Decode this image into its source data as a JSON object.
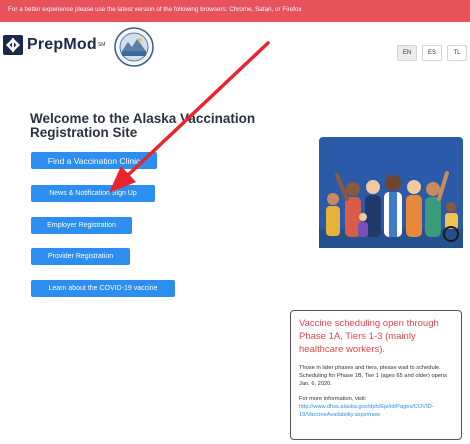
{
  "banner": {
    "text": "For a better experience please use the latest version of the following browsers: Chrome, Safari, or Firefox"
  },
  "header": {
    "logo_text": "PrepMod",
    "logo_mark": "SM"
  },
  "languages": [
    "EN",
    "ES",
    "TL"
  ],
  "main": {
    "title": "Welcome to the Alaska Vaccination Registration Site",
    "buttons": {
      "find": "Find a Vaccination Clinic",
      "news": "News & Notification Sign Up",
      "employer": "Employer Registration",
      "provider": "Provider Registration",
      "learn": "Learn about the COVID-19 vaccine"
    }
  },
  "notice": {
    "heading": "Vaccine scheduling open through Phase 1A, Tiers 1-3 (mainly healthcare workers).",
    "body": "Those in later phases and tiers, please wait to schedule. Scheduling for Phase 1B, Tier 1 (ages 65 and older) opens Jan. 6, 2020.",
    "more_label": "For more information, visit:",
    "link": "http://www.dhss.alaska.gov/dph/Epi/id/Pages/COVID-19/VaccineAvailability.aspx#now"
  },
  "colors": {
    "banner": "#e8525a",
    "button": "#2b8ef0",
    "accent_red": "#e0464e",
    "illustration_bg": "#2b5aa8"
  },
  "icons": {
    "logo": "prepmod-logo-icon",
    "seal": "alaska-state-seal-icon",
    "annotation": "red-arrow-annotation"
  }
}
